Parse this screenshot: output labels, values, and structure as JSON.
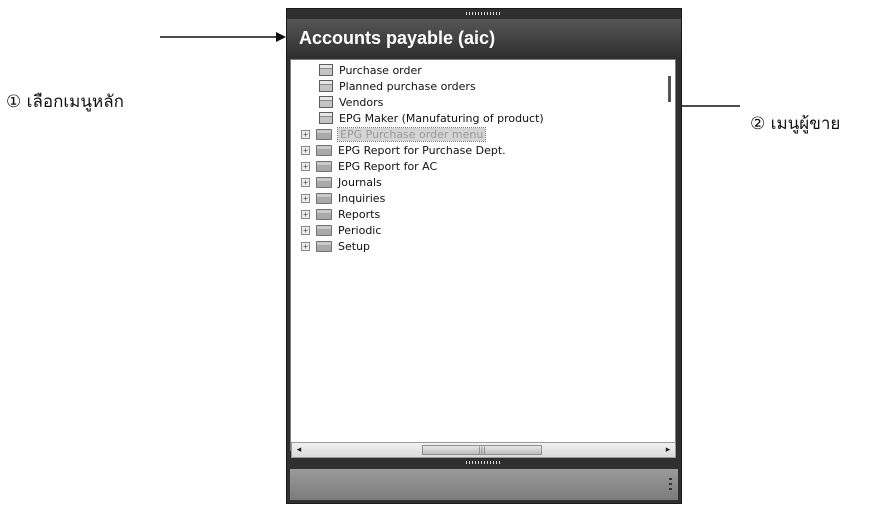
{
  "panel": {
    "title": "Accounts payable (aic)"
  },
  "tree": {
    "documents": [
      {
        "label": "Purchase order"
      },
      {
        "label": "Planned purchase orders"
      },
      {
        "label": "Vendors"
      },
      {
        "label": "EPG Maker (Manufaturing of product)"
      }
    ],
    "folders": [
      {
        "label": "EPG Purchase order menu",
        "selected": true
      },
      {
        "label": "EPG Report for Purchase Dept."
      },
      {
        "label": "EPG Report for AC"
      },
      {
        "label": "Journals"
      },
      {
        "label": "Inquiries"
      },
      {
        "label": "Reports"
      },
      {
        "label": "Periodic"
      },
      {
        "label": "Setup"
      }
    ]
  },
  "annotations": {
    "step1": "① เลือกเมนูหลัก",
    "step2": "② เมนูผู้ขาย"
  },
  "icons": {
    "document": "menu-item-icon",
    "folder": "folder-icon",
    "expand": "expand-plus-icon"
  }
}
